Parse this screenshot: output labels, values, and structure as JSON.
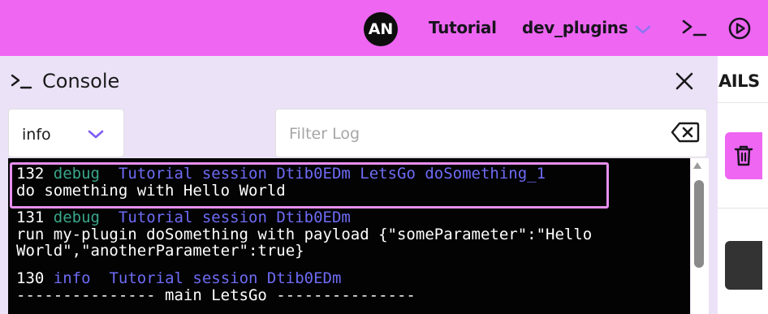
{
  "header": {
    "avatar_initials": "AN",
    "project": "Tutorial",
    "plugin": "dev_plugins",
    "accent": "#ee66f2"
  },
  "right_panel": {
    "title_partial": "AILS"
  },
  "console": {
    "title": "Console",
    "level": "info",
    "filter_placeholder": "Filter Log",
    "logs": [
      {
        "id": "132",
        "level": "debug",
        "context": "Tutorial session Dtib0EDm LetsGo doSomething_1",
        "lines": [
          "do something with Hello World"
        ]
      },
      {
        "id": "131",
        "level": "debug",
        "context": "Tutorial session Dtib0EDm",
        "lines": [
          "run my-plugin doSomething with payload {\"someParameter\":\"Hello",
          "World\",\"anotherParameter\":true}"
        ]
      },
      {
        "id": "130",
        "level": "info",
        "context": "Tutorial session Dtib0EDm",
        "lines": [
          "--------------- main LetsGo ---------------"
        ]
      }
    ]
  }
}
